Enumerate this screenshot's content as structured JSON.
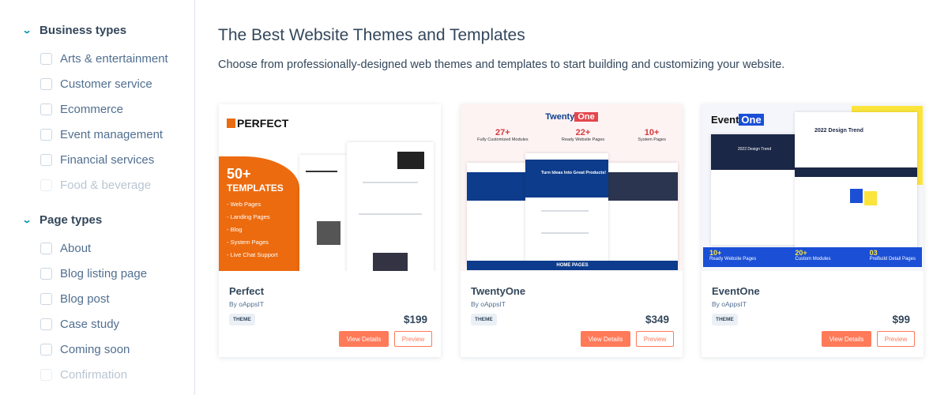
{
  "sidebar": {
    "groups": [
      {
        "title": "Business types",
        "items": [
          "Arts & entertainment",
          "Customer service",
          "Ecommerce",
          "Event management",
          "Financial services",
          "Food & beverage"
        ]
      },
      {
        "title": "Page types",
        "items": [
          "About",
          "Blog listing page",
          "Blog post",
          "Case study",
          "Coming soon",
          "Confirmation"
        ]
      }
    ]
  },
  "main": {
    "title": "The Best Website Themes and Templates",
    "subtitle": "Choose from professionally-designed web themes and templates to start building and customizing your website."
  },
  "cards": [
    {
      "name": "Perfect",
      "author": "By oAppsIT",
      "badge": "THEME",
      "price": "$199",
      "view": "View Details",
      "preview": "Preview",
      "thumb": {
        "logo": "PERFECT",
        "headline": "50+",
        "headline2": "TEMPLATES",
        "bullets": [
          "- Web Pages",
          "- Landing Pages",
          "- Blog",
          "- System Pages",
          "- Live Chat Support"
        ],
        "accent": "#ec6b0f"
      }
    },
    {
      "name": "TwentyOne",
      "author": "By oAppsIT",
      "badge": "THEME",
      "price": "$349",
      "view": "View Details",
      "preview": "Preview",
      "thumb": {
        "logo1": "Twenty",
        "logo2": "One",
        "stats": [
          {
            "n": "27+",
            "l": "Fully Customized Modules"
          },
          {
            "n": "22+",
            "l": "Ready Website Pages"
          },
          {
            "n": "10+",
            "l": "System Pages"
          }
        ],
        "hero": "Turn Ideas Into Great Products!",
        "footer": "HOME PAGES",
        "accent": "#0d3c8c"
      }
    },
    {
      "name": "EventOne",
      "author": "By oAppsIT",
      "badge": "THEME",
      "price": "$99",
      "view": "View Details",
      "preview": "Preview",
      "thumb": {
        "logo1": "Event",
        "logo2": "One",
        "hero": "2022 Design Trend",
        "stats": [
          {
            "n": "10+",
            "l": "Ready Website Pages"
          },
          {
            "n": "20+",
            "l": "Custom Modules"
          },
          {
            "n": "03",
            "l": "PreBuild Detail Pages"
          }
        ],
        "accent": "#1a4fd6",
        "yellow": "#fbe43b"
      }
    }
  ],
  "colors": {
    "primary_button": "#ff7a59",
    "link_accent": "#0091ae",
    "text": "#33475b"
  }
}
